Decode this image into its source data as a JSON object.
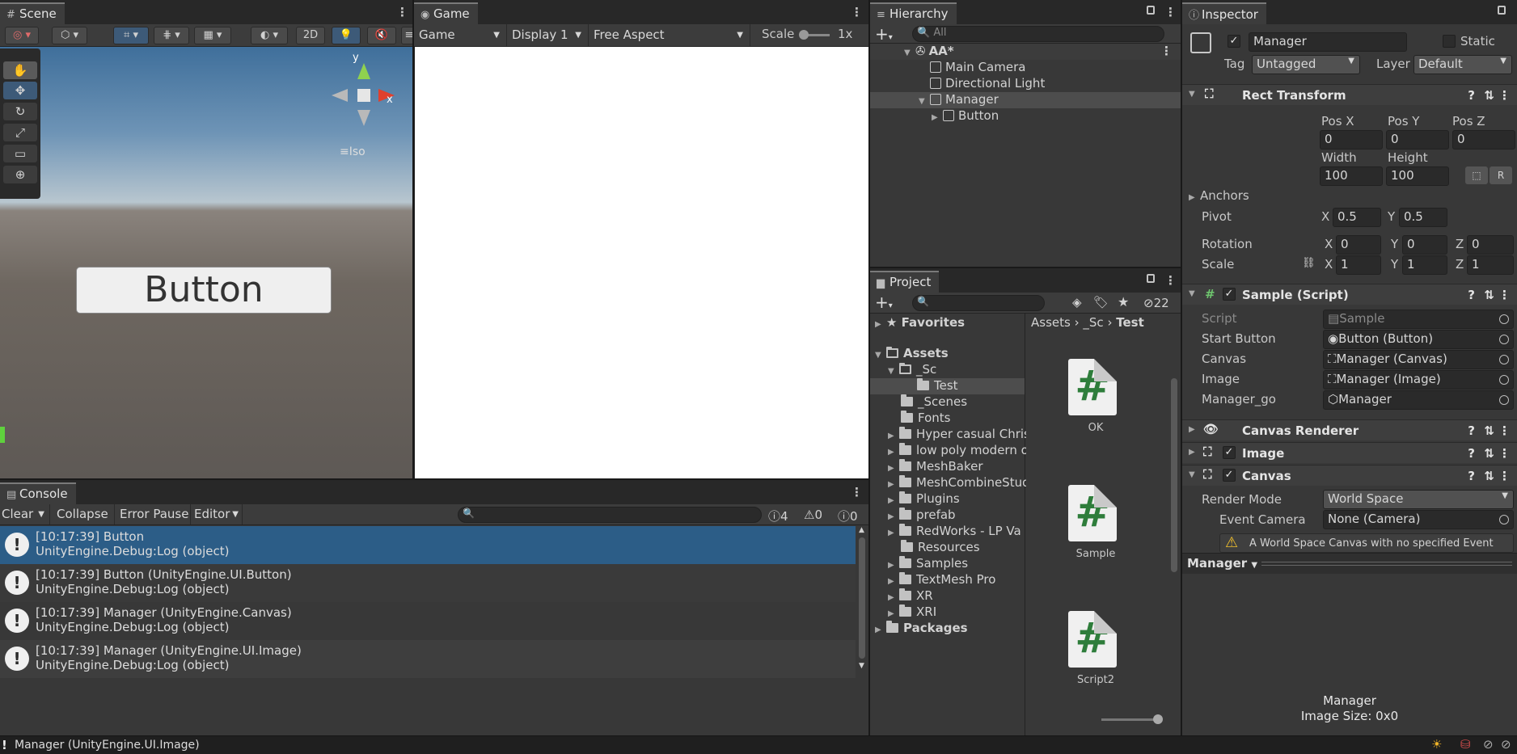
{
  "scene": {
    "tab": "Scene",
    "toolbar": {
      "mode_2d": "2D"
    },
    "gizmo": {
      "y": "y",
      "x": "x",
      "projection": "Iso"
    },
    "button_text": "Button"
  },
  "game": {
    "tab": "Game",
    "display_mode": "Game",
    "display": "Display 1",
    "aspect": "Free Aspect",
    "scale_label": "Scale",
    "scale_value": "1x"
  },
  "hierarchy": {
    "tab": "Hierarchy",
    "search_placeholder": "All",
    "items": [
      {
        "label": "AA*",
        "level": 0
      },
      {
        "label": "Main Camera",
        "level": 1
      },
      {
        "label": "Directional Light",
        "level": 1
      },
      {
        "label": "Manager",
        "level": 1
      },
      {
        "label": "Button",
        "level": 2
      }
    ]
  },
  "project": {
    "tab": "Project",
    "hidden_count": "22",
    "tree": [
      {
        "label": "Favorites"
      },
      {
        "label": "Assets"
      },
      {
        "label": "_Sc"
      },
      {
        "label": "Test"
      },
      {
        "label": "_Scenes"
      },
      {
        "label": "Fonts"
      },
      {
        "label": "Hyper casual Chris"
      },
      {
        "label": "low poly modern o"
      },
      {
        "label": "MeshBaker"
      },
      {
        "label": "MeshCombineStud"
      },
      {
        "label": "Plugins"
      },
      {
        "label": "prefab"
      },
      {
        "label": "RedWorks - LP Va"
      },
      {
        "label": "Resources"
      },
      {
        "label": "Samples"
      },
      {
        "label": "TextMesh Pro"
      },
      {
        "label": "XR"
      },
      {
        "label": "XRI"
      },
      {
        "label": "Packages"
      }
    ],
    "breadcrumb": [
      "Assets",
      "_Sc",
      "Test"
    ],
    "files": [
      {
        "name": "OK",
        "icon": "csharp-script-icon"
      },
      {
        "name": "Sample",
        "icon": "csharp-script-icon"
      },
      {
        "name": "Script2",
        "icon": "csharp-script-icon"
      }
    ]
  },
  "inspector": {
    "tab": "Inspector",
    "object_name": "Manager",
    "static_label": "Static",
    "tag_label": "Tag",
    "tag_value": "Untagged",
    "layer_label": "Layer",
    "layer_value": "Default",
    "rect_transform": {
      "title": "Rect Transform",
      "pos_x_label": "Pos X",
      "pos_y_label": "Pos Y",
      "pos_z_label": "Pos Z",
      "pos_x": "0",
      "pos_y": "0",
      "pos_z": "0",
      "width_label": "Width",
      "height_label": "Height",
      "width": "100",
      "height": "100",
      "anchors_label": "Anchors",
      "pivot_label": "Pivot",
      "pivot_x": "0.5",
      "pivot_y": "0.5",
      "rotation_label": "Rotation",
      "rot_x": "0",
      "rot_y": "0",
      "rot_z": "0",
      "scale_label": "Scale",
      "scale_x": "1",
      "scale_y": "1",
      "scale_z": "1",
      "x": "X",
      "y": "Y",
      "z": "Z"
    },
    "sample_script": {
      "title": "Sample (Script)",
      "fields": [
        {
          "label": "Script",
          "value": "Sample"
        },
        {
          "label": "Start Button",
          "value": "Button (Button)"
        },
        {
          "label": "Canvas",
          "value": "Manager (Canvas)"
        },
        {
          "label": "Image",
          "value": "Manager (Image)"
        },
        {
          "label": "Manager_go",
          "value": "Manager"
        }
      ]
    },
    "canvas_renderer": "Canvas Renderer",
    "image": "Image",
    "canvas": {
      "title": "Canvas",
      "render_mode_label": "Render Mode",
      "render_mode": "World Space",
      "event_camera_label": "Event Camera",
      "event_camera": "None (Camera)",
      "warning": "A World Space Canvas with no specified Event"
    },
    "preview_dropdown": "Manager",
    "preview_title": "Manager",
    "preview_info": "Image Size: 0x0"
  },
  "console": {
    "tab": "Console",
    "clear": "Clear",
    "collapse": "Collapse",
    "error_pause": "Error Pause",
    "editor": "Editor",
    "count_log": "4",
    "count_warn": "0",
    "count_error": "0",
    "entries": [
      {
        "line1": "[10:17:39] Button",
        "line2": "UnityEngine.Debug:Log (object)"
      },
      {
        "line1": "[10:17:39] Button (UnityEngine.UI.Button)",
        "line2": "UnityEngine.Debug:Log (object)"
      },
      {
        "line1": "[10:17:39] Manager (UnityEngine.Canvas)",
        "line2": "UnityEngine.Debug:Log (object)"
      },
      {
        "line1": "[10:17:39] Manager (UnityEngine.UI.Image)",
        "line2": "UnityEngine.Debug:Log (object)"
      }
    ]
  },
  "status_bar": {
    "message": "Manager (UnityEngine.UI.Image)"
  }
}
